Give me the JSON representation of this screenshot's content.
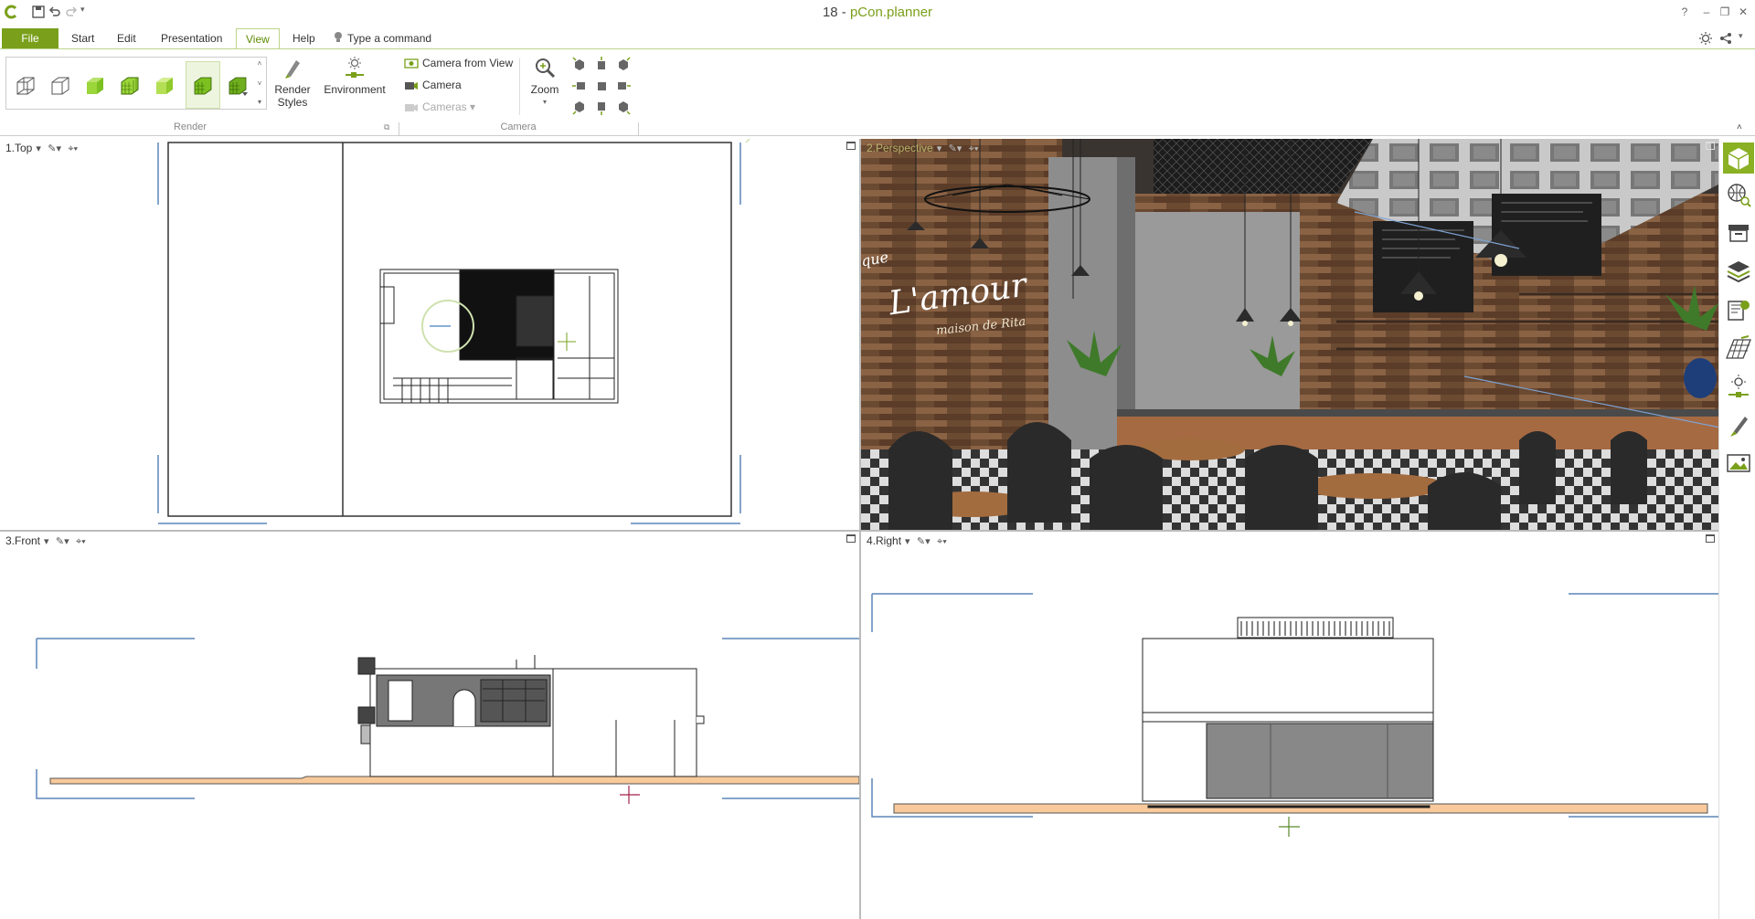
{
  "window": {
    "title_prefix": "18 - ",
    "title_brand": "pCon.planner",
    "controls": {
      "help": "?",
      "minimize": "–",
      "restore": "❐",
      "close": "✕"
    }
  },
  "menu": {
    "tabs": [
      {
        "label": "File"
      },
      {
        "label": "Start"
      },
      {
        "label": "Edit"
      },
      {
        "label": "Presentation"
      },
      {
        "label": "View",
        "active": true
      },
      {
        "label": "Help"
      }
    ],
    "command_placeholder": "Type a command"
  },
  "ribbon": {
    "render_styles_label_1": "Render",
    "render_styles_label_2": "Styles",
    "environment_label": "Environment",
    "camera_from_view_label": "Camera from View",
    "camera_label": "Camera",
    "cameras_label": "Cameras",
    "zoom_label": "Zoom",
    "group_render": "Render",
    "group_camera": "Camera"
  },
  "viewports": {
    "top": {
      "label": "1.Top"
    },
    "perspective": {
      "label": "2.Perspective",
      "sign_text_1": "L'amour",
      "sign_text_2": "maison de Rita",
      "sign_text_3": "que"
    },
    "front": {
      "label": "3.Front"
    },
    "right": {
      "label": "4.Right"
    }
  },
  "colors": {
    "accent": "#7aa01b",
    "bracket": "#5b86b8",
    "floor": "#f8c99a",
    "wood": "#8a5a3a"
  },
  "right_panel_icons": [
    "3d-box-icon",
    "globe-search-icon",
    "archive-icon",
    "layers-icon",
    "settings-panel-icon",
    "grid-perspective-icon",
    "light-icon",
    "pen-style-icon",
    "image-icon"
  ]
}
